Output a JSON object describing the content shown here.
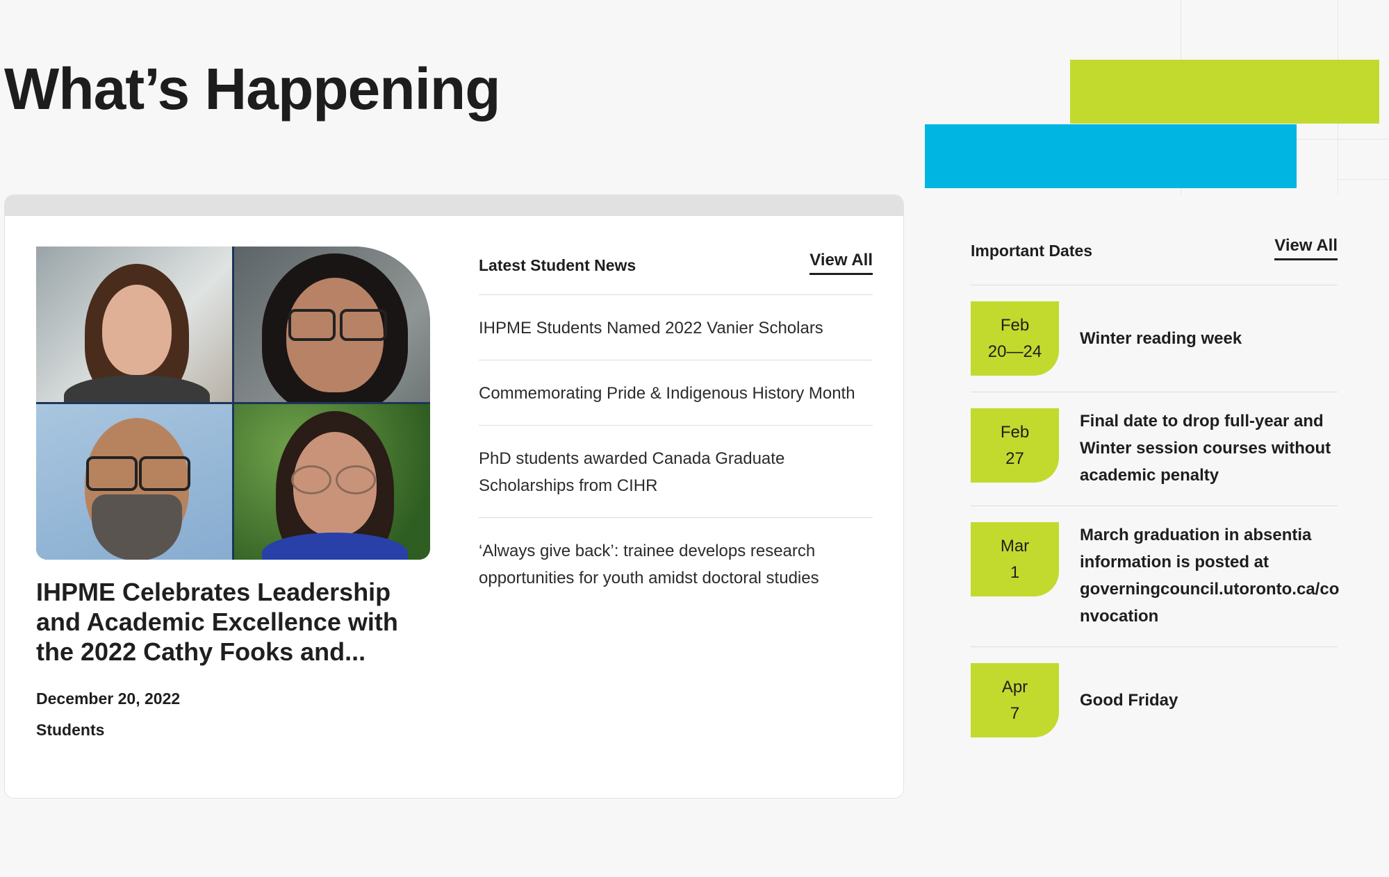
{
  "page": {
    "title": "What’s Happening"
  },
  "colors": {
    "accent_green": "#c2da2e",
    "accent_blue": "#00b5e2"
  },
  "feature": {
    "image_alt": "Four student portraits collage",
    "title": "IHPME Celebrates Leadership and Academic Excellence with the 2022 Cathy Fooks and...",
    "date": "December 20, 2022",
    "category": "Students"
  },
  "news": {
    "heading": "Latest Student News",
    "view_all": "View All",
    "items": [
      "IHPME Students Named 2022 Vanier Scholars",
      "Commemorating Pride & Indigenous History Month",
      "PhD students awarded Canada Graduate Scholarships from CIHR",
      "‘Always give back’: trainee develops research opportunities for youth amidst doctoral studies"
    ]
  },
  "dates": {
    "heading": "Important Dates",
    "view_all": "View All",
    "items": [
      {
        "month": "Feb",
        "day": "20—24",
        "text": "Winter reading week"
      },
      {
        "month": "Feb",
        "day": "27",
        "text": "Final date to drop full-year and Winter session courses without academic penalty"
      },
      {
        "month": "Mar",
        "day": "1",
        "text": "March graduation in absentia information is posted at governingcouncil.utoronto.ca/convocation"
      },
      {
        "month": "Apr",
        "day": "7",
        "text": "Good Friday"
      }
    ]
  }
}
